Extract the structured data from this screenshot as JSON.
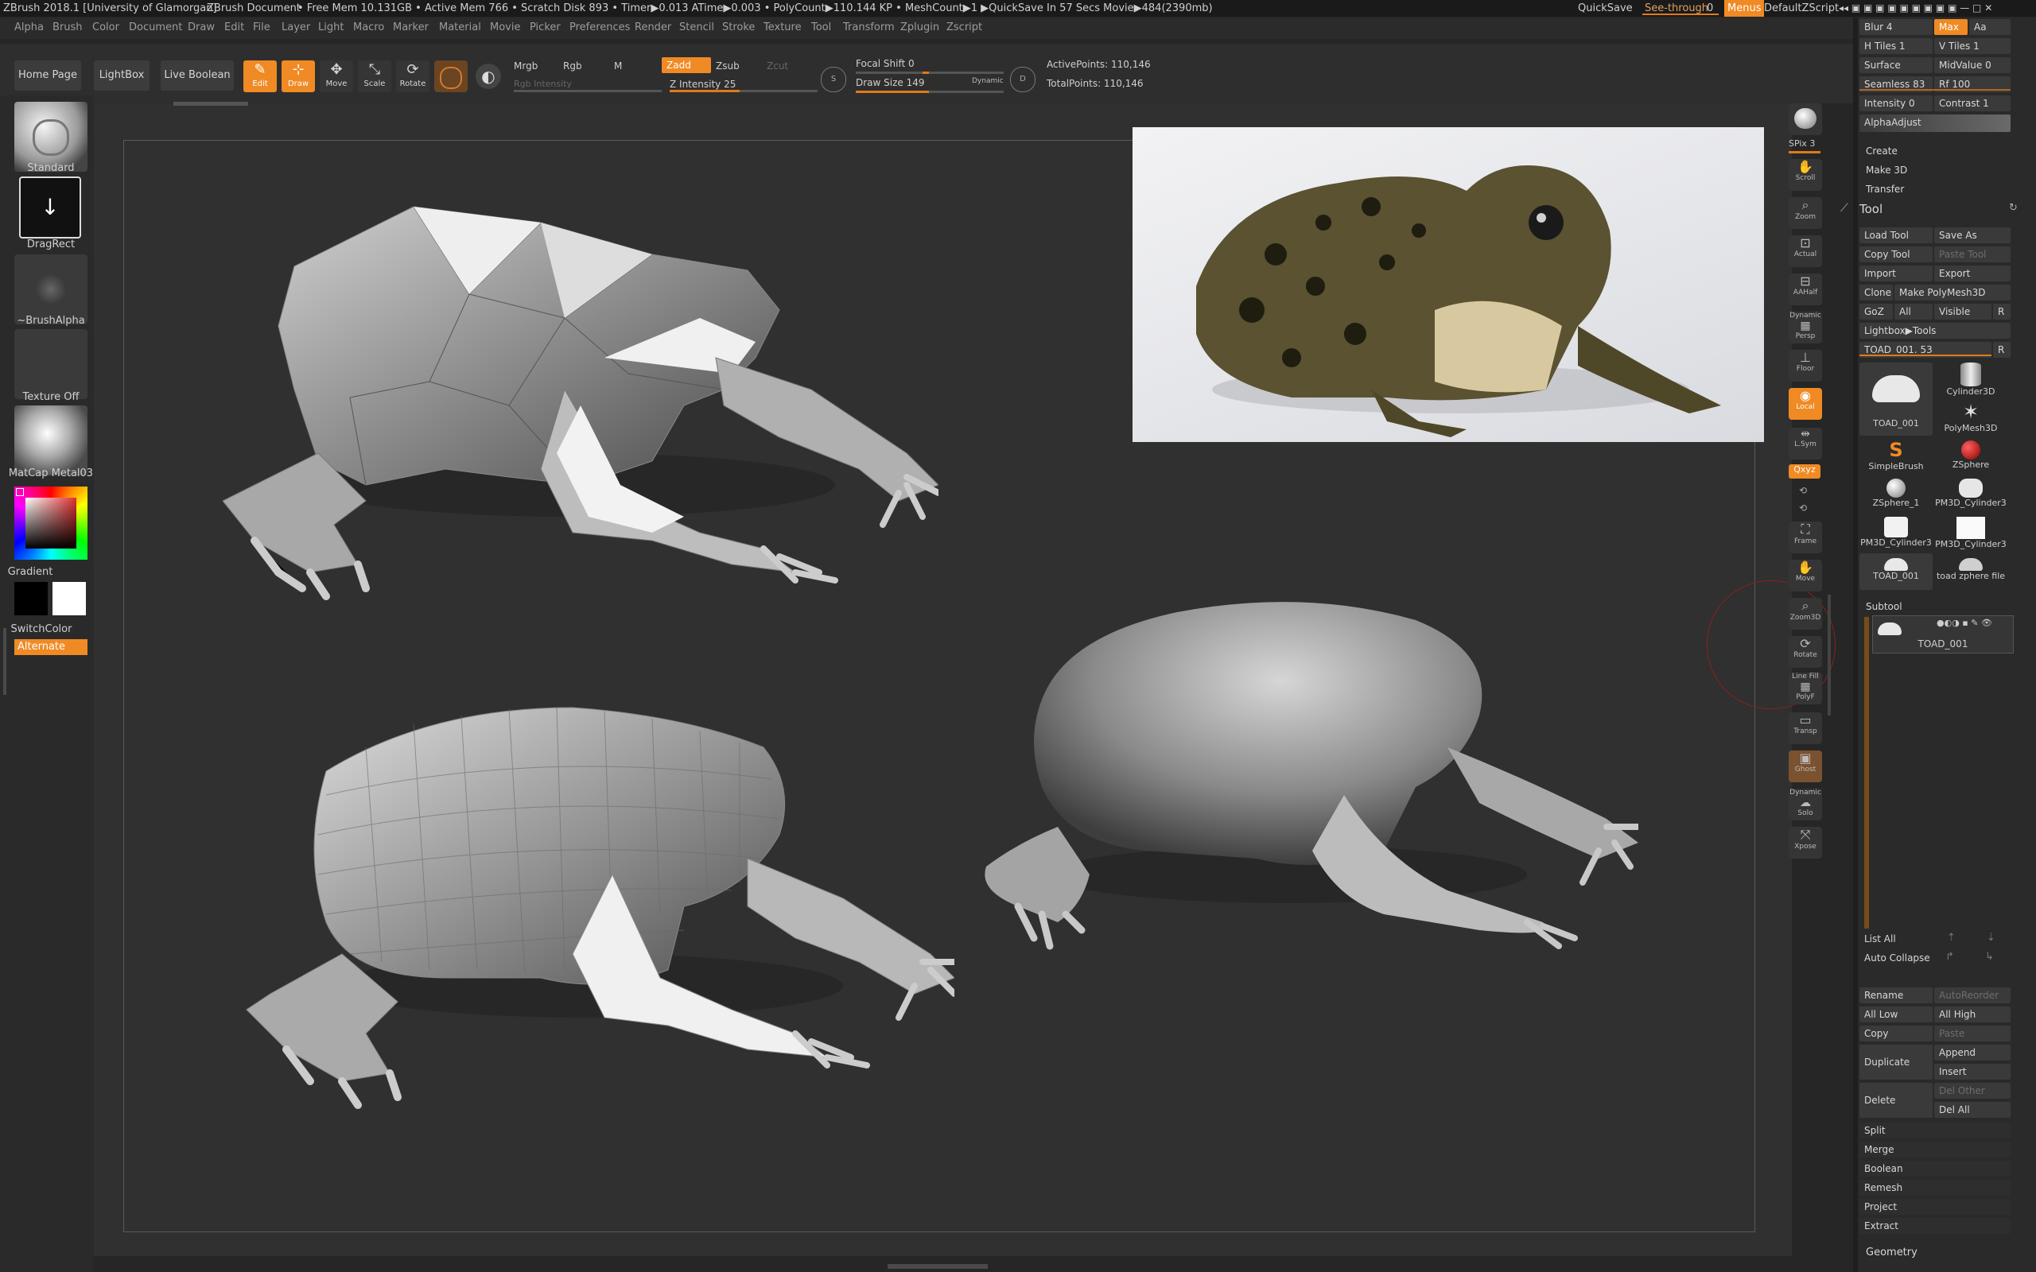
{
  "titlebar": {
    "app_title": "ZBrush 2018.1 [University of Glamorgan]",
    "document": "ZBrush Document",
    "status": "• Free Mem 10.131GB • Active Mem 766 • Scratch Disk 893 • Timer▶0.013 ATime▶0.003 • PolyCount▶110.144 KP • MeshCount▶1 ▶QuickSave In 57 Secs Movie▶484(2390mb)",
    "quicksave": "QuickSave",
    "seethrough": "See-through",
    "seethrough_value": "0",
    "menus": "Menus",
    "script": "DefaultZScript"
  },
  "menubar": [
    "Alpha",
    "Brush",
    "Color",
    "Document",
    "Draw",
    "Edit",
    "File",
    "Layer",
    "Light",
    "Macro",
    "Marker",
    "Material",
    "Movie",
    "Picker",
    "Preferences",
    "Render",
    "Stencil",
    "Stroke",
    "Texture",
    "Tool",
    "Transform",
    "Zplugin",
    "Zscript"
  ],
  "shelf": {
    "home_page": "Home Page",
    "lightbox": "LightBox",
    "live_boolean": "Live Boolean",
    "edit": "Edit",
    "draw": "Draw",
    "move": "Move",
    "scale": "Scale",
    "rotate": "Rotate",
    "mrgb": "Mrgb",
    "rgb": "Rgb",
    "m": "M",
    "rgb_intensity": "Rgb Intensity",
    "zadd": "Zadd",
    "zsub": "Zsub",
    "zcut": "Zcut",
    "z_intensity": "Z Intensity 25",
    "focal_shift": "Focal Shift 0",
    "draw_size": "Draw Size 149",
    "dynamic": "Dynamic",
    "active_points": "ActivePoints: 110,146",
    "total_points": "TotalPoints: 110,146"
  },
  "left": {
    "brush": "Standard",
    "stroke": "DragRect",
    "alpha": "~BrushAlpha",
    "texture": "Texture Off",
    "material": "MatCap Metal03",
    "gradient": "Gradient",
    "switchcolor": "SwitchColor",
    "alternate": "Alternate"
  },
  "righttools": [
    "BPR",
    "SPix 3",
    "Scroll",
    "Zoom",
    "Actual",
    "AAHalf",
    "Persp",
    "Floor",
    "Local",
    "L.Sym",
    "Frame",
    "Move",
    "Zoom3D",
    "Rotate",
    "Line Fill",
    "PolyF",
    "Transp",
    "Ghost",
    "Solo",
    "Xpose"
  ],
  "tray": {
    "blur": "Blur 4",
    "max": "Max",
    "aa": "Aa",
    "htiles": "H Tiles 1",
    "vtiles": "V Tiles 1",
    "surface": "Surface",
    "midvalue": "MidValue 0",
    "seamless": "Seamless 83",
    "rf": "Rf 100",
    "intensity": "Intensity 0",
    "contrast": "Contrast 1",
    "alphaadjust": "AlphaAdjust",
    "create": "Create",
    "make3d": "Make 3D",
    "transfer": "Transfer",
    "tool_title": "Tool",
    "load_tool": "Load Tool",
    "save_as": "Save As",
    "copy_tool": "Copy Tool",
    "paste_tool": "Paste Tool",
    "import": "Import",
    "export": "Export",
    "clone": "Clone",
    "make_polymesh": "Make PolyMesh3D",
    "goz": "GoZ",
    "all": "All",
    "visible": "Visible",
    "r": "R",
    "lightbox_tools": "Lightbox▶Tools",
    "toad_slider": "TOAD_001. 53",
    "tools": [
      "TOAD_001",
      "Cylinder3D",
      "PolyMesh3D",
      "SimpleBrush",
      "ZSphere",
      "ZSphere_1",
      "PM3D_Cylinder3",
      "PM3D_Cylinder3",
      "PM3D_Cylinder3",
      "TOAD_001",
      "toad zphere file"
    ],
    "subtool_title": "Subtool",
    "subtool_name": "TOAD_001",
    "list_all": "List All",
    "auto_collapse": "Auto Collapse",
    "rename": "Rename",
    "autoreorder": "AutoReorder",
    "all_low": "All Low",
    "all_high": "All High",
    "copy": "Copy",
    "paste": "Paste",
    "duplicate": "Duplicate",
    "append": "Append",
    "insert": "Insert",
    "delete": "Delete",
    "del_other": "Del Other",
    "del_all": "Del All",
    "split": "Split",
    "merge": "Merge",
    "boolean": "Boolean",
    "remesh": "Remesh",
    "project": "Project",
    "extract": "Extract",
    "geometry": "Geometry"
  },
  "colors": {
    "accent": "#f08a24",
    "background": "#262626",
    "canvas": "#303030"
  }
}
